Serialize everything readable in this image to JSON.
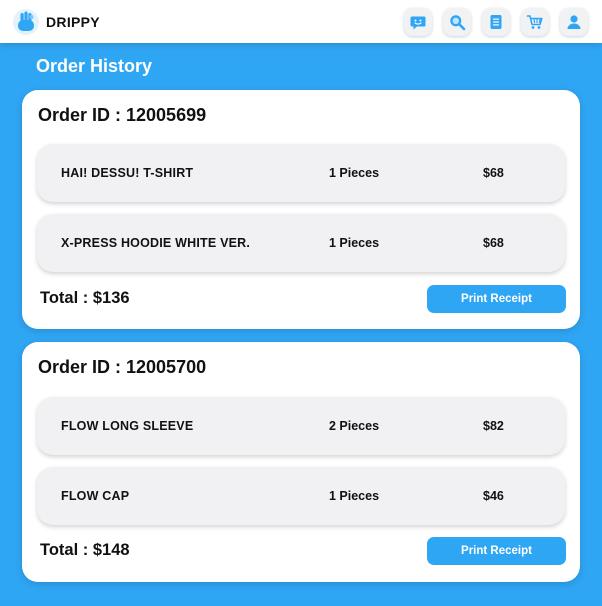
{
  "app": {
    "name": "DRIPPY",
    "accent_color": "#2fa6f4",
    "logo_icon": "hand-logo-icon"
  },
  "nav": {
    "icons": [
      "chat-icon",
      "search-icon",
      "document-icon",
      "cart-icon",
      "user-icon"
    ]
  },
  "page": {
    "title": "Order History"
  },
  "orders": [
    {
      "id_label": "Order ID : 12005699",
      "items": [
        {
          "name": "HAI! DESSU! T-SHIRT",
          "qty": "1 Pieces",
          "price": "$68"
        },
        {
          "name": "X-PRESS HOODIE WHITE VER.",
          "qty": "1 Pieces",
          "price": "$68"
        }
      ],
      "total_label": "Total : $136",
      "print_label": "Print Receipt"
    },
    {
      "id_label": "Order ID : 12005700",
      "items": [
        {
          "name": "FLOW LONG SLEEVE",
          "qty": "2 Pieces",
          "price": "$82"
        },
        {
          "name": "FLOW CAP",
          "qty": "1 Pieces",
          "price": "$46"
        }
      ],
      "total_label": "Total : $148",
      "print_label": "Print Receipt"
    }
  ]
}
